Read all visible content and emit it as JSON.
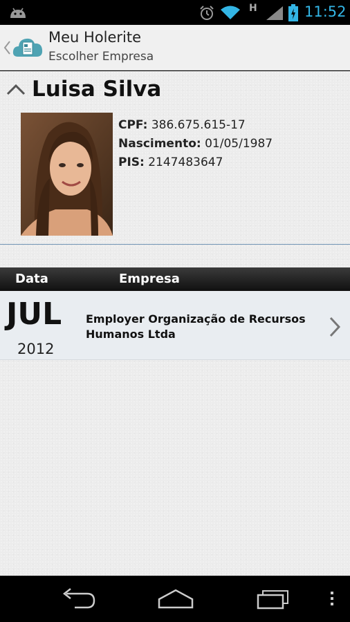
{
  "status_bar": {
    "network_type": "H",
    "time": "11:52"
  },
  "action_bar": {
    "title": "Meu Holerite",
    "subtitle": "Escolher Empresa"
  },
  "profile": {
    "name": "Luisa Silva",
    "cpf_label": "CPF:",
    "cpf_value": "386.675.615-17",
    "birth_label": "Nascimento:",
    "birth_value": "01/05/1987",
    "pis_label": "PIS:",
    "pis_value": "2147483647"
  },
  "table": {
    "headers": {
      "date": "Data",
      "company": "Empresa"
    },
    "rows": [
      {
        "month": "JUL",
        "year": "2012",
        "company": "Employer Organização de Recursos Humanos Ltda"
      }
    ]
  },
  "colors": {
    "accent": "#33b5e5",
    "divider": "#6f93b4"
  },
  "icons": {
    "status": [
      "android-icon",
      "alarm-icon",
      "wifi-icon",
      "signal-icon",
      "battery-icon"
    ],
    "nav": [
      "back-icon",
      "home-icon",
      "recent-apps-icon",
      "menu-icon"
    ]
  }
}
